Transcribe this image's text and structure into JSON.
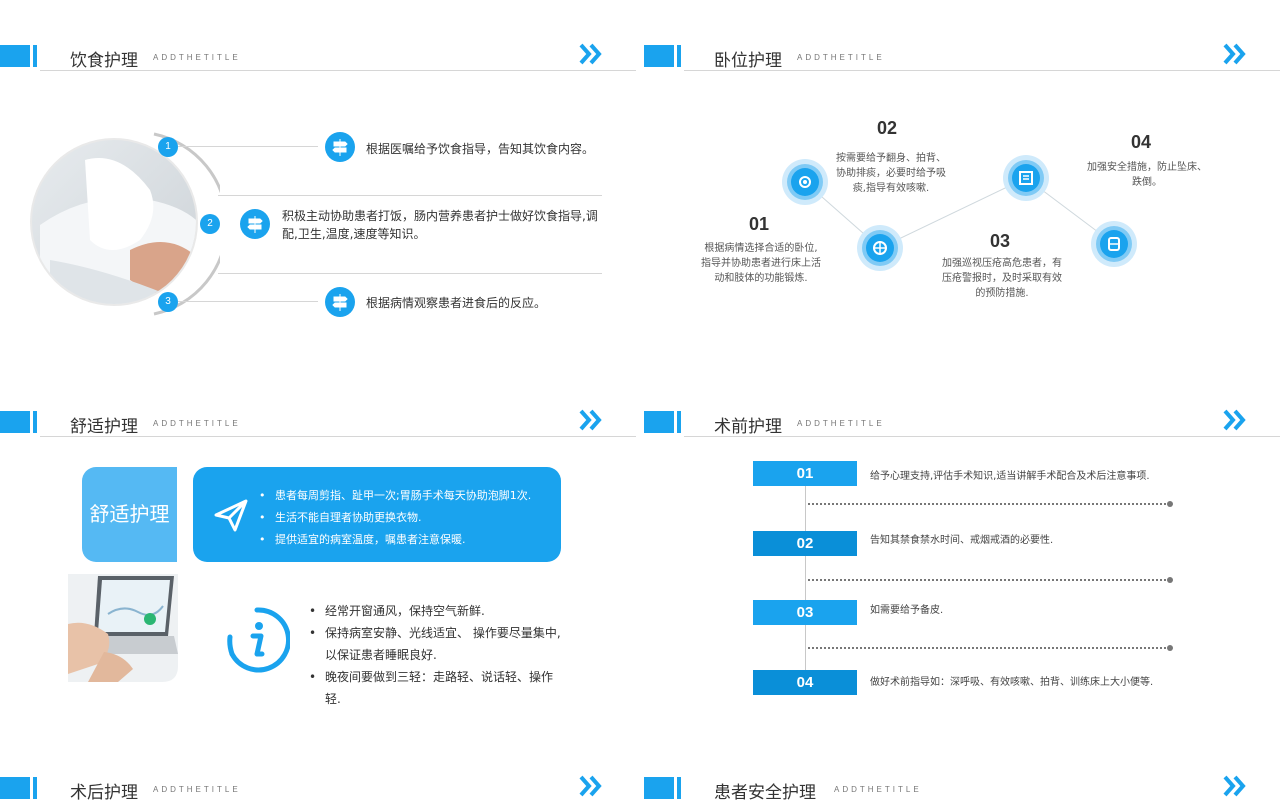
{
  "header_subtitle": "ADDTHETITLE",
  "panels": {
    "diet": {
      "title": "饮食护理",
      "items": [
        {
          "num": "1",
          "text": "根据医嘱给予饮食指导，告知其饮食内容。"
        },
        {
          "num": "2",
          "text": "积极主动协助患者打饭，肠内营养患者护士做好饮食指导,调配,卫生,温度,速度等知识。"
        },
        {
          "num": "3",
          "text": "根据病情观察患者进食后的反应。"
        }
      ]
    },
    "position": {
      "title": "卧位护理",
      "items": [
        {
          "num": "01",
          "text": "根据病情选择合适的卧位,指导并协助患者进行床上活动和肢体的功能锻炼."
        },
        {
          "num": "02",
          "text": "按需要给予翻身、拍背、协助排痰，必要时给予吸痰,指导有效咳嗽."
        },
        {
          "num": "03",
          "text": "加强巡视压疮高危患者，有压疮警报时，及时采取有效的预防措施."
        },
        {
          "num": "04",
          "text": "加强安全措施，防止坠床、跌倒。"
        }
      ]
    },
    "comfort": {
      "title": "舒适护理",
      "label": "舒适护理",
      "top_bullets": [
        "患者每周剪指、趾甲一次;胃肠手术每天协助泡脚1次.",
        "生活不能自理者协助更换衣物.",
        "提供适宜的病室温度，嘱患者注意保暖."
      ],
      "bottom_bullets": [
        "经常开窗通风，保持空气新鲜.",
        "保持病室安静、光线适宜、 操作要尽量集中,以保证患者睡眠良好.",
        "晚夜间要做到三轻：走路轻、说话轻、操作轻."
      ]
    },
    "preop": {
      "title": "术前护理",
      "steps": [
        {
          "num": "01",
          "text": "给予心理支持,评估手术知识,适当讲解手术配合及术后注意事项."
        },
        {
          "num": "02",
          "text": "告知其禁食禁水时间、戒烟戒酒的必要性."
        },
        {
          "num": "03",
          "text": "如需要给予备皮."
        },
        {
          "num": "04",
          "text": "做好术前指导如：深呼吸、有效咳嗽、拍背、训练床上大小便等."
        }
      ]
    },
    "postop": {
      "title": "术后护理"
    },
    "safety": {
      "title": "患者安全护理"
    }
  },
  "colors": {
    "accent": "#1aa3ee",
    "accent_light": "#55b9f3",
    "accent_dark": "#0a8fd8"
  }
}
